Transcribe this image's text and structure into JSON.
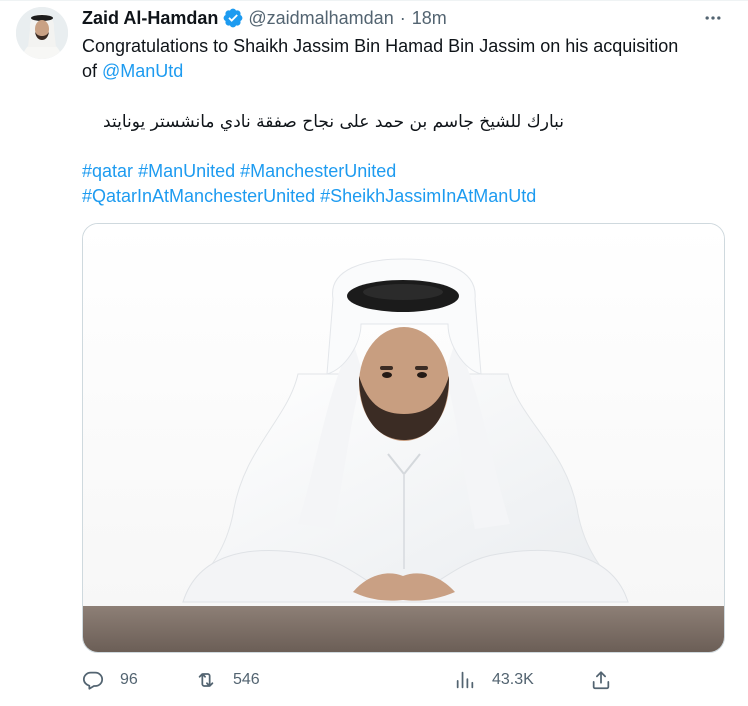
{
  "tweet": {
    "author": {
      "name": "Zaid Al-Hamdan",
      "handle": "@zaidmalhamdan",
      "separator": "·",
      "time": "18m"
    },
    "text": {
      "line1": "Congratulations to Shaikh Jassim Bin Hamad Bin Jassim on his acquisition",
      "line2_prefix": "of ",
      "mention": "@ManUtd",
      "arabic": "نبارك للشيخ جاسم بن حمد على نجاح صفقة نادي مانشستر يونايتد"
    },
    "hashtags": {
      "row1": [
        "#qatar",
        "#ManUnited",
        "#ManchesterUnited"
      ],
      "row2": [
        "#QatarInAtManchesterUnited",
        "#SheikhJassimInAtManUtd"
      ]
    },
    "stats": {
      "replies": "96",
      "retweets": "546",
      "views": "43.3K"
    }
  },
  "colors": {
    "text": "#0f1419",
    "secondary": "#536471",
    "link": "#1d9bf0",
    "border": "#cfd9de",
    "verified": "#1d9bf0"
  },
  "icons": [
    "more-icon",
    "verified-icon",
    "reply-icon",
    "retweet-icon",
    "views-icon",
    "share-icon"
  ]
}
